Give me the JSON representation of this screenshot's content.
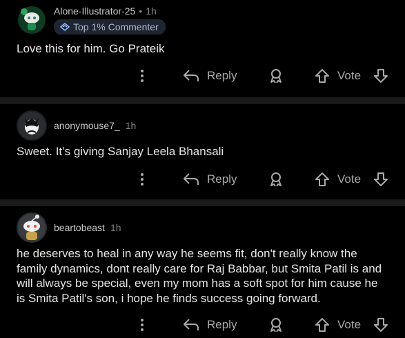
{
  "actions": {
    "reply_label": "Reply",
    "vote_label": "Vote"
  },
  "comments": [
    {
      "username": "Alone-Illustrator-25",
      "time": "1h",
      "badge": "Top 1% Commenter",
      "body": "Love this for him. Go Prateik",
      "avatar_color": "#1e8f4e"
    },
    {
      "username": "anonymouse7_",
      "time": "1h",
      "body": "Sweet. It’s giving Sanjay Leela Bhansali",
      "avatar_color": "#1d1f22"
    },
    {
      "username": "beartobeast",
      "time": "1h",
      "body": "he deserves to heal in any way he seems fit, don't really know the family dynamics, dont really care for Raj Babbar, but Smita Patil is and will always be special, even my mom has a soft spot for him cause he is Smita Patil's son, i hope he finds success going forward.",
      "avatar_color": "#2b2d31"
    }
  ]
}
